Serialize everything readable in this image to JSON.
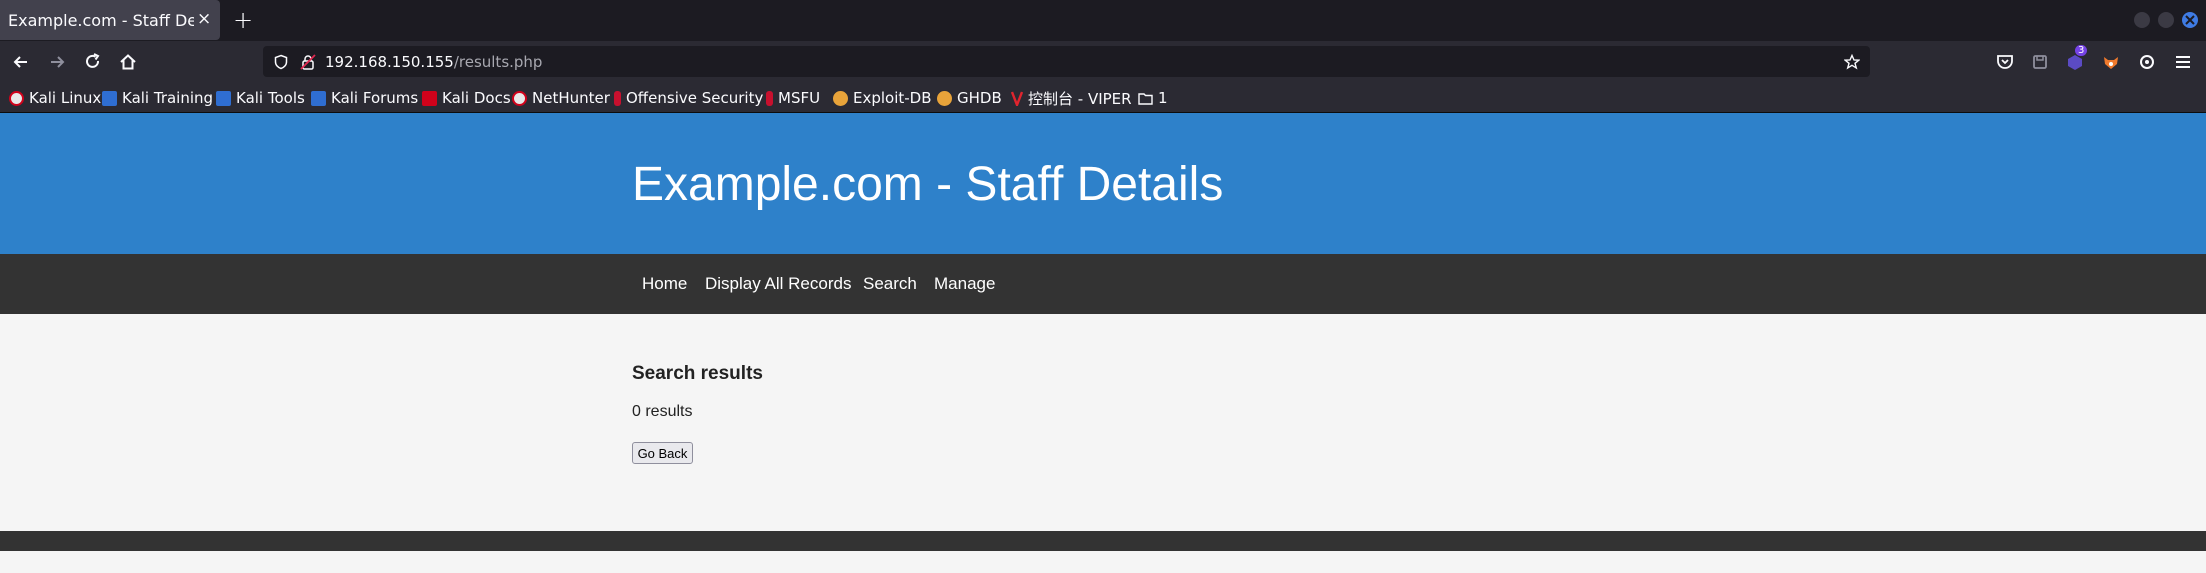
{
  "tab": {
    "title": "Example.com - Staff Details - Mozilla Firefox",
    "close": "×"
  },
  "new_tab": "+",
  "address": {
    "host": "192.168.150.155",
    "path": "/results.php"
  },
  "extension_badge": "3",
  "bookmarks": [
    {
      "label": "Kali Linux",
      "icon": "kali-icon"
    },
    {
      "label": "Kali Training",
      "icon": "kali-training-icon"
    },
    {
      "label": "Kali Tools",
      "icon": "kali-tools-icon"
    },
    {
      "label": "Kali Forums",
      "icon": "kali-forums-icon"
    },
    {
      "label": "Kali Docs",
      "icon": "kali-docs-icon"
    },
    {
      "label": "NetHunter",
      "icon": "nethunter-icon"
    },
    {
      "label": "Offensive Security",
      "icon": "offsec-icon"
    },
    {
      "label": "MSFU",
      "icon": "msfu-icon"
    },
    {
      "label": "Exploit-DB",
      "icon": "exploit-db-icon"
    },
    {
      "label": "GHDB",
      "icon": "ghdb-icon"
    },
    {
      "label": "控制台 - VIPER",
      "icon": "viper-icon"
    },
    {
      "label": "1",
      "icon": "folder-icon"
    }
  ],
  "site": {
    "title": "Example.com - Staff Details",
    "nav": [
      "Home",
      "Display All Records",
      "Search",
      "Manage"
    ],
    "results_heading": "Search results",
    "results_count": "0 results",
    "go_back_label": "Go Back"
  },
  "colors": {
    "banner": "#2e81ca",
    "navbar": "#333333",
    "page_background": "#f5f5f5",
    "browser_toolbar": "#2b2a33"
  }
}
